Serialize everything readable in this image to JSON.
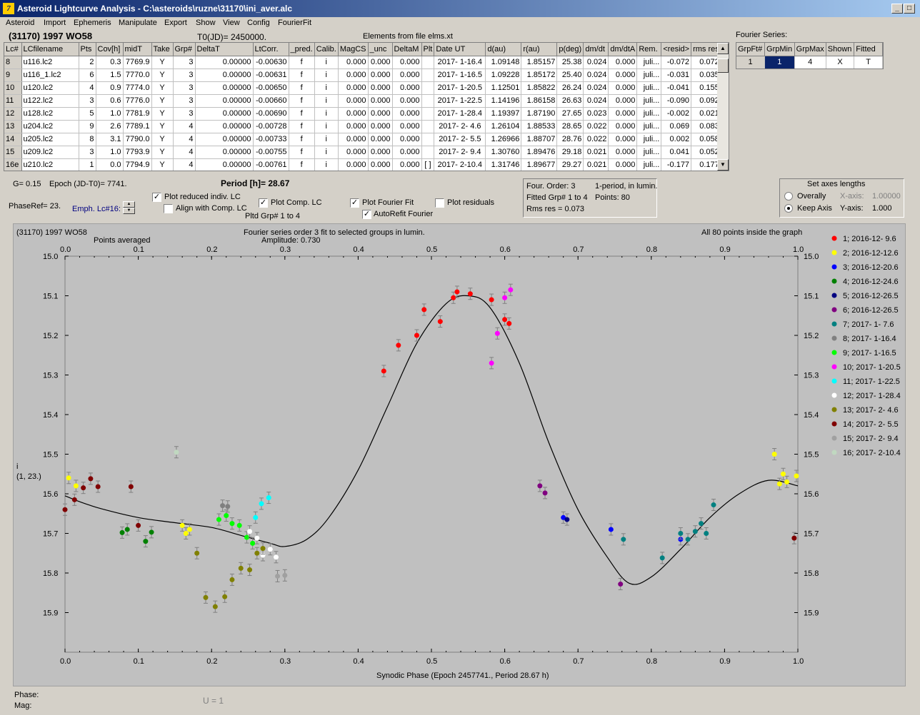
{
  "window": {
    "title": "Asteroid Lightcurve Analysis - C:\\asteroids\\ruzne\\31170\\ini_aver.alc",
    "icon": "app-icon"
  },
  "menu": [
    "Asteroid",
    "Import",
    "Ephemeris",
    "Manipulate",
    "Export",
    "Show",
    "View",
    "Config",
    "FourierFit"
  ],
  "header": {
    "asteroid": "(31170) 1997 WO58",
    "t0": "T0(JD)= 2450000.",
    "elements": "Elements from file elms.xt",
    "fourier_label": "Fourier Series:"
  },
  "table": {
    "headers": [
      "Lc#",
      "LCfilename",
      "Pts",
      "Cov[h]",
      "midT",
      "Take",
      "Grp#",
      "DeltaT",
      "LtCorr.",
      "_pred.",
      "Calib.",
      "MagCS",
      "_unc",
      "DeltaM",
      "Plt",
      "Date UT",
      "d(au)",
      "r(au)",
      "p(deg)",
      "dm/dt",
      "dm/dtA",
      "Rem.",
      "<resid>",
      "rms res"
    ],
    "rows": [
      [
        "8",
        "u116.lc2",
        "2",
        "0.3",
        "7769.9",
        "Y",
        "3",
        "0.00000",
        "-0.00630",
        "f",
        "i",
        "0.000",
        "0.000",
        "0.000",
        "",
        "2017- 1-16.4",
        "1.09148",
        "1.85157",
        "25.38",
        "0.024",
        "0.000",
        "juli...",
        "-0.072",
        "0.072"
      ],
      [
        "9",
        "u116_1.lc2",
        "6",
        "1.5",
        "7770.0",
        "Y",
        "3",
        "0.00000",
        "-0.00631",
        "f",
        "i",
        "0.000",
        "0.000",
        "0.000",
        "",
        "2017- 1-16.5",
        "1.09228",
        "1.85172",
        "25.40",
        "0.024",
        "0.000",
        "juli...",
        "-0.031",
        "0.035"
      ],
      [
        "10",
        "u120.lc2",
        "4",
        "0.9",
        "7774.0",
        "Y",
        "3",
        "0.00000",
        "-0.00650",
        "f",
        "i",
        "0.000",
        "0.000",
        "0.000",
        "",
        "2017- 1-20.5",
        "1.12501",
        "1.85822",
        "26.24",
        "0.024",
        "0.000",
        "juli...",
        "-0.041",
        "0.155"
      ],
      [
        "11",
        "u122.lc2",
        "3",
        "0.6",
        "7776.0",
        "Y",
        "3",
        "0.00000",
        "-0.00660",
        "f",
        "i",
        "0.000",
        "0.000",
        "0.000",
        "",
        "2017- 1-22.5",
        "1.14196",
        "1.86158",
        "26.63",
        "0.024",
        "0.000",
        "juli...",
        "-0.090",
        "0.092"
      ],
      [
        "12",
        "u128.lc2",
        "5",
        "1.0",
        "7781.9",
        "Y",
        "3",
        "0.00000",
        "-0.00690",
        "f",
        "i",
        "0.000",
        "0.000",
        "0.000",
        "",
        "2017- 1-28.4",
        "1.19397",
        "1.87190",
        "27.65",
        "0.023",
        "0.000",
        "juli...",
        "-0.002",
        "0.021"
      ],
      [
        "13",
        "u204.lc2",
        "9",
        "2.6",
        "7789.1",
        "Y",
        "4",
        "0.00000",
        "-0.00728",
        "f",
        "i",
        "0.000",
        "0.000",
        "0.000",
        "",
        "2017- 2- 4.6",
        "1.26104",
        "1.88533",
        "28.65",
        "0.022",
        "0.000",
        "juli...",
        "0.069",
        "0.083"
      ],
      [
        "14",
        "u205.lc2",
        "8",
        "3.1",
        "7790.0",
        "Y",
        "4",
        "0.00000",
        "-0.00733",
        "f",
        "i",
        "0.000",
        "0.000",
        "0.000",
        "",
        "2017- 2- 5.5",
        "1.26966",
        "1.88707",
        "28.76",
        "0.022",
        "0.000",
        "juli...",
        "0.002",
        "0.058"
      ],
      [
        "15",
        "u209.lc2",
        "3",
        "1.0",
        "7793.9",
        "Y",
        "4",
        "0.00000",
        "-0.00755",
        "f",
        "i",
        "0.000",
        "0.000",
        "0.000",
        "",
        "2017- 2- 9.4",
        "1.30760",
        "1.89476",
        "29.18",
        "0.021",
        "0.000",
        "juli...",
        "0.041",
        "0.052"
      ],
      [
        "16e",
        "u210.lc2",
        "1",
        "0.0",
        "7794.9",
        "Y",
        "4",
        "0.00000",
        "-0.00761",
        "f",
        "i",
        "0.000",
        "0.000",
        "0.000",
        "[ ]",
        "2017- 2-10.4",
        "1.31746",
        "1.89677",
        "29.27",
        "0.021",
        "0.000",
        "juli...",
        "-0.177",
        "0.177"
      ]
    ]
  },
  "fourier_table": {
    "headers": [
      "GrpFt#",
      "GrpMin",
      "GrpMax",
      "Shown",
      "Fitted"
    ],
    "row": [
      "1",
      "1",
      "4",
      "X",
      "T"
    ]
  },
  "controls": {
    "g": "G= 0.15",
    "epoch": "Epoch (JD-T0)= 7741.",
    "period": "Period [h]= 28.67",
    "phaseref": "PhaseRef= 23.",
    "emph": "Emph. Lc#16:",
    "plot_reduced": "Plot reduced indiv. LC",
    "align": "Align with Comp. LC",
    "plot_comp": "Plot Comp. LC",
    "pltd_grp": "Pltd Grp#  1   to   4",
    "plot_fourier": "Plot Fourier Fit",
    "autorefit": "AutoRefit Fourier",
    "plot_residuals": "Plot residuals",
    "four_order": "Four. Order:  3",
    "one_period": "1-period, in lumin.",
    "fitted_grp": "Fitted Grp# 1 to 4",
    "points": "Points: 80",
    "rms": "Rms res      = 0.073",
    "axes_title": "Set axes lengths",
    "overally": "Overally",
    "keep_axis": "Keep Axis",
    "xaxis_label": "X-axis:",
    "xaxis_val": "1.00000",
    "yaxis_label": "Y-axis:",
    "yaxis_val": "1.000"
  },
  "footer": {
    "phase": "Phase:",
    "mag": "Mag:",
    "u": "U = 1"
  },
  "chart_data": {
    "type": "scatter",
    "title": "Fourier series order 3 fit to selected groups in lumin.",
    "subtitle": "Amplitude: 0.730",
    "top_left": "(31170) 1997 WO58",
    "points_note": "Points averaged",
    "right_note": "All 80 points inside the graph",
    "xlabel": "Synodic Phase (Epoch 2457741., Period 28.67 h)",
    "ylabel": "i",
    "ylabel2": "(1, 23.)",
    "xlim": [
      0,
      1
    ],
    "ylim": [
      15.0,
      16.0
    ],
    "xticks": [
      "0.0",
      "0.1",
      "0.2",
      "0.3",
      "0.4",
      "0.5",
      "0.6",
      "0.7",
      "0.8",
      "0.9",
      "1.0"
    ],
    "yticks": [
      "15.0",
      "15.1",
      "15.2",
      "15.3",
      "15.4",
      "15.5",
      "15.6",
      "15.7",
      "15.8",
      "15.9"
    ],
    "fit_curve": [
      [
        0,
        15.605
      ],
      [
        0.02,
        15.62
      ],
      [
        0.05,
        15.638
      ],
      [
        0.1,
        15.66
      ],
      [
        0.15,
        15.673
      ],
      [
        0.2,
        15.685
      ],
      [
        0.24,
        15.705
      ],
      [
        0.28,
        15.725
      ],
      [
        0.3,
        15.733
      ],
      [
        0.33,
        15.715
      ],
      [
        0.36,
        15.66
      ],
      [
        0.4,
        15.54
      ],
      [
        0.44,
        15.38
      ],
      [
        0.48,
        15.22
      ],
      [
        0.52,
        15.12
      ],
      [
        0.55,
        15.1
      ],
      [
        0.58,
        15.13
      ],
      [
        0.62,
        15.27
      ],
      [
        0.66,
        15.47
      ],
      [
        0.7,
        15.64
      ],
      [
        0.74,
        15.76
      ],
      [
        0.77,
        15.826
      ],
      [
        0.8,
        15.81
      ],
      [
        0.84,
        15.74
      ],
      [
        0.88,
        15.66
      ],
      [
        0.92,
        15.6
      ],
      [
        0.96,
        15.566
      ],
      [
        1.0,
        15.58
      ]
    ],
    "series": [
      {
        "name": "1; 2016-12- 9.6",
        "color": "#ff0000",
        "points": [
          [
            0.435,
            15.29
          ],
          [
            0.455,
            15.225
          ],
          [
            0.48,
            15.2
          ],
          [
            0.49,
            15.135
          ],
          [
            0.512,
            15.165
          ],
          [
            0.53,
            15.105
          ],
          [
            0.535,
            15.09
          ],
          [
            0.553,
            15.095
          ],
          [
            0.582,
            15.11
          ],
          [
            0.6,
            15.16
          ],
          [
            0.606,
            15.17
          ]
        ]
      },
      {
        "name": "2; 2016-12-12.6",
        "color": "#ffff00",
        "points": [
          [
            0.005,
            15.56
          ],
          [
            0.015,
            15.58
          ],
          [
            0.16,
            15.68
          ],
          [
            0.165,
            15.7
          ],
          [
            0.17,
            15.69
          ],
          [
            0.968,
            15.5
          ],
          [
            0.975,
            15.575
          ],
          [
            0.98,
            15.55
          ],
          [
            0.985,
            15.57
          ],
          [
            0.998,
            15.555
          ]
        ]
      },
      {
        "name": "3; 2016-12-20.6",
        "color": "#0000ff",
        "points": [
          [
            0.68,
            15.66
          ],
          [
            0.745,
            15.69
          ],
          [
            0.84,
            15.715
          ]
        ]
      },
      {
        "name": "4; 2016-12-24.6",
        "color": "#008000",
        "points": [
          [
            0.078,
            15.698
          ],
          [
            0.085,
            15.69
          ],
          [
            0.11,
            15.72
          ],
          [
            0.118,
            15.697
          ]
        ]
      },
      {
        "name": "5; 2016-12-26.5",
        "color": "#000080",
        "points": [
          [
            0.685,
            15.665
          ]
        ]
      },
      {
        "name": "6; 2016-12-26.5",
        "color": "#800080",
        "points": [
          [
            0.648,
            15.58
          ],
          [
            0.655,
            15.598
          ],
          [
            0.758,
            15.828
          ]
        ]
      },
      {
        "name": "7; 2017- 1- 7.6",
        "color": "#008080",
        "points": [
          [
            0.762,
            15.715
          ],
          [
            0.815,
            15.762
          ],
          [
            0.84,
            15.7
          ],
          [
            0.85,
            15.715
          ],
          [
            0.86,
            15.695
          ],
          [
            0.868,
            15.675
          ],
          [
            0.875,
            15.7
          ],
          [
            0.885,
            15.628
          ]
        ]
      },
      {
        "name": "8; 2017- 1-16.4",
        "color": "#808080",
        "points": [
          [
            0.215,
            15.63
          ],
          [
            0.222,
            15.632
          ]
        ]
      },
      {
        "name": "9; 2017- 1-16.5",
        "color": "#00ff00",
        "points": [
          [
            0.21,
            15.665
          ],
          [
            0.22,
            15.655
          ],
          [
            0.228,
            15.675
          ],
          [
            0.238,
            15.68
          ],
          [
            0.248,
            15.71
          ],
          [
            0.256,
            15.725
          ]
        ]
      },
      {
        "name": "10; 2017- 1-20.5",
        "color": "#ff00ff",
        "points": [
          [
            0.582,
            15.27
          ],
          [
            0.59,
            15.195
          ],
          [
            0.6,
            15.105
          ],
          [
            0.608,
            15.085
          ]
        ]
      },
      {
        "name": "11; 2017- 1-22.5",
        "color": "#00ffff",
        "points": [
          [
            0.26,
            15.66
          ],
          [
            0.268,
            15.625
          ],
          [
            0.278,
            15.61
          ]
        ]
      },
      {
        "name": "12; 2017- 1-28.4",
        "color": "#ffffff",
        "points": [
          [
            0.252,
            15.695
          ],
          [
            0.262,
            15.712
          ],
          [
            0.27,
            15.755
          ],
          [
            0.28,
            15.74
          ],
          [
            0.288,
            15.76
          ]
        ]
      },
      {
        "name": "13; 2017- 2- 4.6",
        "color": "#808000",
        "points": [
          [
            0.18,
            15.75
          ],
          [
            0.192,
            15.862
          ],
          [
            0.205,
            15.885
          ],
          [
            0.218,
            15.86
          ],
          [
            0.228,
            15.817
          ],
          [
            0.24,
            15.788
          ],
          [
            0.252,
            15.792
          ],
          [
            0.262,
            15.75
          ],
          [
            0.27,
            15.738
          ]
        ]
      },
      {
        "name": "14; 2017- 2- 5.5",
        "color": "#800000",
        "points": [
          [
            0.0,
            15.64
          ],
          [
            0.013,
            15.615
          ],
          [
            0.025,
            15.585
          ],
          [
            0.035,
            15.562
          ],
          [
            0.045,
            15.582
          ],
          [
            0.09,
            15.582
          ],
          [
            0.1,
            15.68
          ],
          [
            0.995,
            15.712
          ]
        ]
      },
      {
        "name": "15; 2017- 2- 9.4",
        "color": "#a0a0a0",
        "points": [
          [
            0.29,
            15.808
          ],
          [
            0.3,
            15.806
          ]
        ]
      },
      {
        "name": "16; 2017- 2-10.4",
        "color": "#c0d8c0",
        "points": [
          [
            0.152,
            15.495
          ]
        ]
      }
    ]
  }
}
